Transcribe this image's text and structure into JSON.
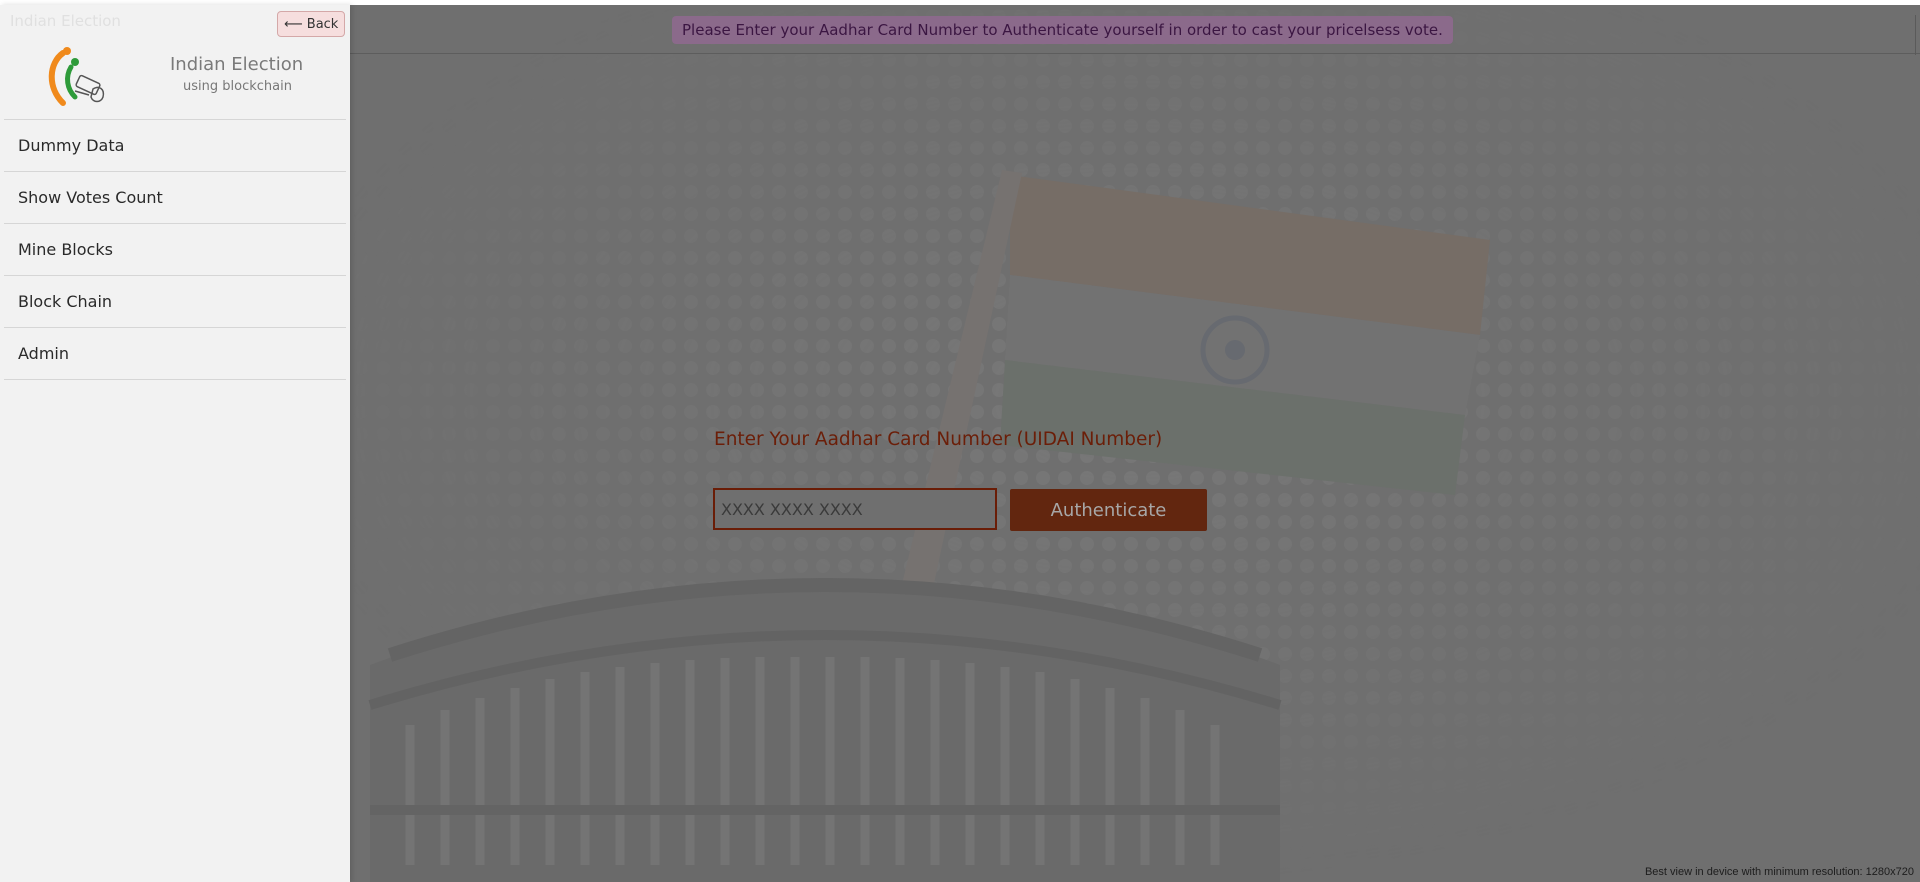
{
  "sidebar": {
    "back_label": "⟵ Back",
    "ghost_text": "Indian Election",
    "brand": {
      "title": "Indian Election",
      "subtitle": "using blockchain"
    },
    "menu": [
      {
        "label": "Dummy Data"
      },
      {
        "label": "Show Votes Count"
      },
      {
        "label": "Mine Blocks"
      },
      {
        "label": "Block Chain"
      },
      {
        "label": "Admin"
      }
    ]
  },
  "main": {
    "banner": "Please Enter your Aadhar Card Number to Authenticate yourself in order to cast your pricelsess vote.",
    "auth": {
      "label": "Enter Your Aadhar Card Number (UIDAI Number)",
      "input_placeholder": "XXXX XXXX XXXX",
      "input_value": "",
      "button_label": "Authenticate"
    },
    "footnote": "Best view in device with minimum resolution: 1280x720"
  },
  "colors": {
    "accent": "#6a1d07",
    "button": "#62260f",
    "banner_bg": "#8b6a8b",
    "overlay": "#6f6f6f",
    "sidebar_bg": "#f2f2f2",
    "logo_orange": "#f08a1c",
    "logo_green": "#2e9b3a"
  }
}
